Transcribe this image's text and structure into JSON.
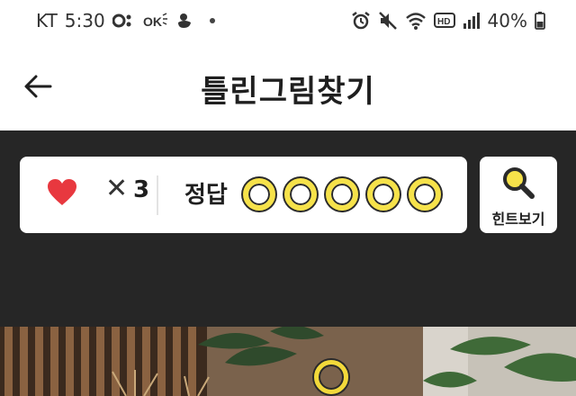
{
  "status_bar": {
    "carrier": "KT",
    "time": "5:30",
    "battery": "40%"
  },
  "header": {
    "title": "틀린그림찾기"
  },
  "game": {
    "lives_symbol": "✕",
    "lives": "3",
    "answer_label": "정답",
    "total_answers": 5,
    "found_answers": 0,
    "hint_label": "힌트보기"
  },
  "colors": {
    "accent_yellow": "#f6e24a",
    "heart_red": "#e8383f",
    "panel_dark": "#262626"
  }
}
